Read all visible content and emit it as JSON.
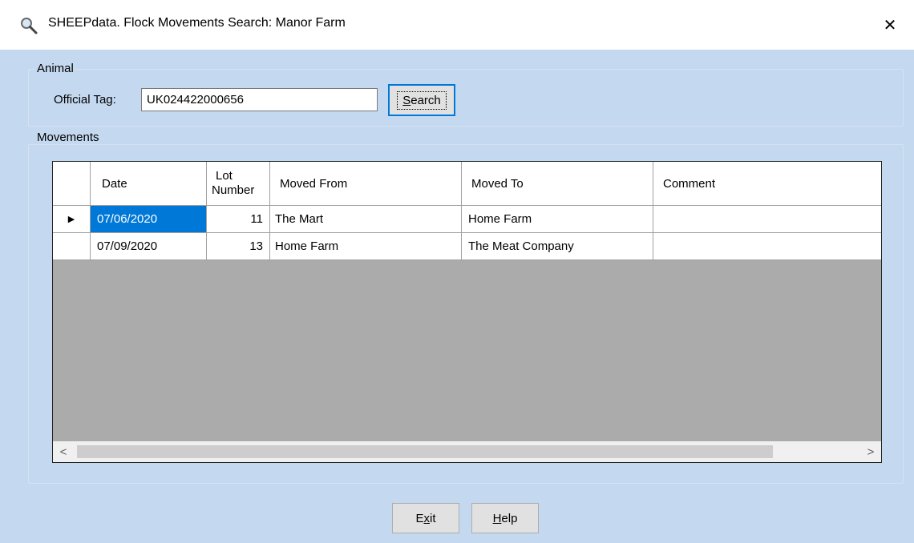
{
  "window": {
    "title": "SHEEPdata. Flock Movements Search: Manor Farm",
    "icon": "search-icon",
    "close_glyph": "✕"
  },
  "animal_group": {
    "label": "Animal",
    "official_tag_label": "Official Tag:",
    "official_tag_value": "UK024422000656",
    "search_button": {
      "prefix": "",
      "accel": "S",
      "rest": "earch"
    }
  },
  "movements_group": {
    "label": "Movements",
    "columns": {
      "date": "Date",
      "lot_number_line1": "Lot",
      "lot_number_line2": "Number",
      "moved_from": "Moved From",
      "moved_to": "Moved To",
      "comment": "Comment"
    },
    "rows": [
      {
        "date": "07/06/2020",
        "lot": "11",
        "moved_from": "The Mart",
        "moved_to": "Home Farm",
        "comment": "",
        "current": true
      },
      {
        "date": "07/09/2020",
        "lot": "13",
        "moved_from": "Home Farm",
        "moved_to": "The Meat Company",
        "comment": "",
        "current": false
      }
    ],
    "scroll_left": "<",
    "scroll_right": ">"
  },
  "footer": {
    "exit_button": {
      "prefix": "E",
      "accel": "x",
      "rest": "it"
    },
    "help_button": {
      "prefix": "",
      "accel": "H",
      "rest": "elp"
    }
  },
  "colors": {
    "window_bg": "#c4d8ef",
    "selection": "#0078d7",
    "grid_empty": "#ababab"
  }
}
